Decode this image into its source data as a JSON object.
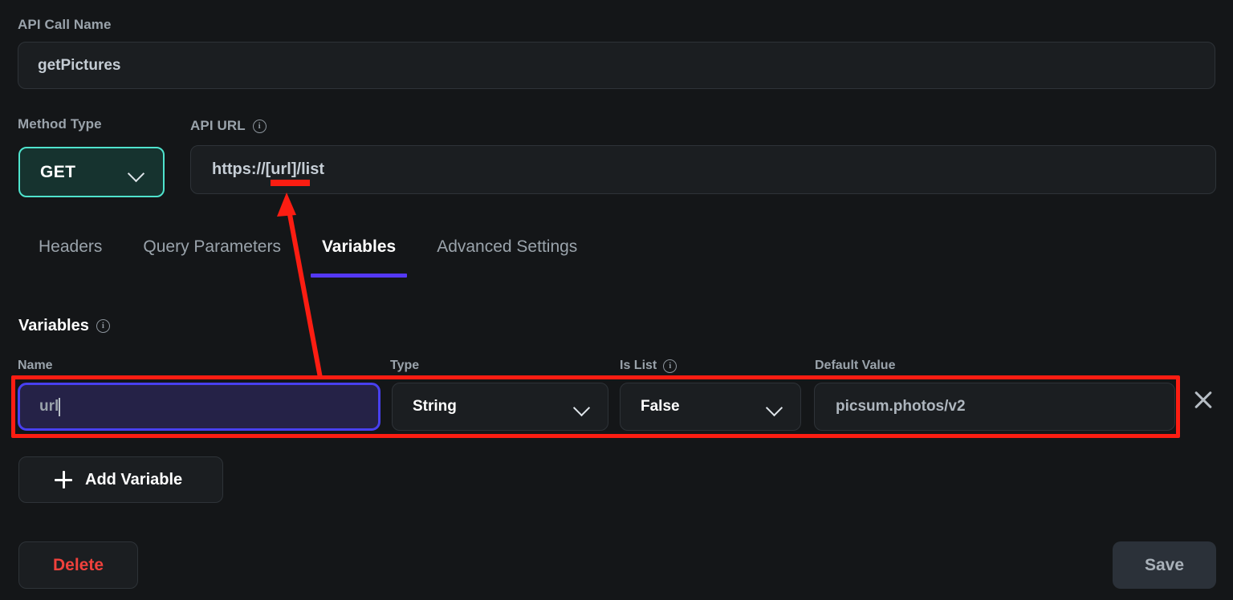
{
  "form": {
    "api_call_name": {
      "label": "API Call Name",
      "value": "getPictures"
    },
    "method_type": {
      "label": "Method Type",
      "value": "GET",
      "chevron_icon": "chevron-down-icon"
    },
    "api_url": {
      "label": "API URL",
      "info_icon": "info-icon",
      "info_glyph": "i",
      "value": "https://[url]/list"
    }
  },
  "tabs": [
    {
      "label": "Headers",
      "active": false
    },
    {
      "label": "Query Parameters",
      "active": false
    },
    {
      "label": "Variables",
      "active": true
    },
    {
      "label": "Advanced Settings",
      "active": false
    }
  ],
  "variables_section": {
    "title": "Variables",
    "info_icon": "info-icon",
    "info_glyph": "i",
    "columns": {
      "name": "Name",
      "type": "Type",
      "is_list": "Is List",
      "default_value": "Default Value"
    },
    "is_list_info_glyph": "i",
    "rows": [
      {
        "name": "url",
        "type": "String",
        "is_list": "False",
        "default_value": "picsum.photos/v2",
        "remove_icon": "close-icon"
      }
    ],
    "add_button": {
      "label": "Add Variable",
      "icon": "plus-icon"
    }
  },
  "footer": {
    "delete_label": "Delete",
    "save_label": "Save"
  },
  "colors": {
    "background": "#141618",
    "panel": "#1b1e21",
    "border": "#2e3338",
    "accent_tab": "#5438f5",
    "accent_method": "#4fe3cd",
    "method_fill": "#16332f",
    "focus_border": "#4840f0",
    "focus_fill": "#252247",
    "danger": "#f0413c",
    "annotation": "#fc1d12",
    "text_primary": "#ffffff",
    "text_secondary": "#9aa3ab"
  },
  "annotations": {
    "underline_target": "[url]",
    "arrow": "arrow pointing from the variable Name field up to the [url] token in the API URL",
    "highlight_target": "variable row"
  }
}
